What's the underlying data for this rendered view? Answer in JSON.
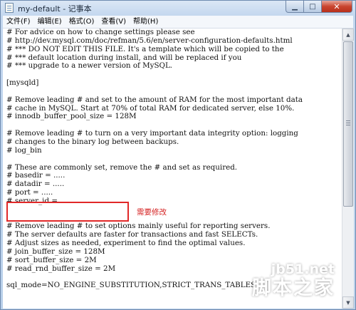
{
  "window": {
    "title": "my-default - 记事本"
  },
  "menu": [
    "文件(F)",
    "编辑(E)",
    "格式(O)",
    "查看(V)",
    "帮助(H)"
  ],
  "lines": [
    "# For advice on how to change settings please see",
    "# http://dev.mysql.com/doc/refman/5.6/en/server-configuration-defaults.html",
    "# *** DO NOT EDIT THIS FILE. It's a template which will be copied to the",
    "# *** default location during install, and will be replaced if you",
    "# *** upgrade to a newer version of MySQL.",
    "",
    "[mysqld]",
    "",
    "# Remove leading # and set to the amount of RAM for the most important data",
    "# cache in MySQL. Start at 70% of total RAM for dedicated server, else 10%.",
    "# innodb_buffer_pool_size = 128M",
    "",
    "# Remove leading # to turn on a very important data integrity option: logging",
    "# changes to the binary log between backups.",
    "# log_bin",
    "",
    "# These are commonly set, remove the # and set as required.",
    "# basedir = .....",
    "# datadir = .....",
    "# port = .....",
    "# server_id = .....",
    "",
    "",
    "# Remove leading # to set options mainly useful for reporting servers.",
    "# The server defaults are faster for transactions and fast SELECTs.",
    "# Adjust sizes as needed, experiment to find the optimal values.",
    "# join_buffer_size = 128M",
    "# sort_buffer_size = 2M",
    "# read_rnd_buffer_size = 2M",
    "",
    "sql_mode=NO_ENGINE_SUBSTITUTION,STRICT_TRANS_TABLES"
  ],
  "annotation": {
    "text": "需要修改",
    "color": "#d42020"
  },
  "watermark": {
    "site": "jb51.net",
    "name": "脚本之家"
  },
  "colors": {
    "close_button": "#c9452f",
    "highlight_box": "#e12828"
  }
}
